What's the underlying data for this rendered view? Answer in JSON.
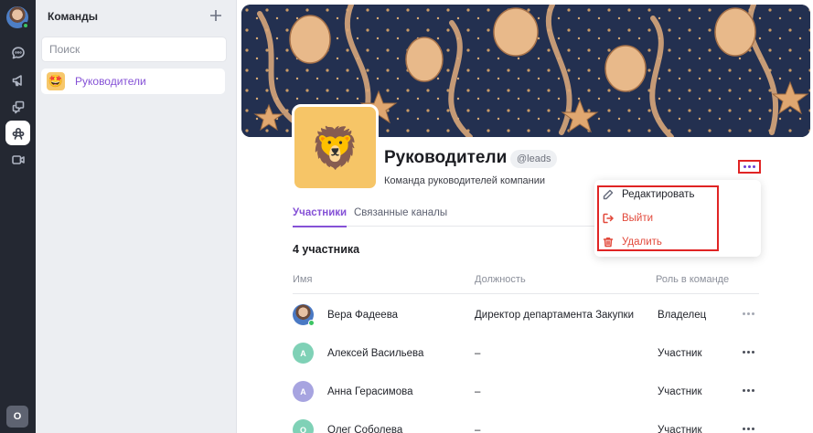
{
  "rail": {
    "items": [
      {
        "icon": "chat-icon"
      },
      {
        "icon": "megaphone-icon"
      },
      {
        "icon": "threads-icon"
      },
      {
        "icon": "teams-icon",
        "active": true
      },
      {
        "icon": "video-icon"
      }
    ],
    "user_initial": "O"
  },
  "sidebar": {
    "title": "Команды",
    "search_placeholder": "Поиск",
    "teams": [
      {
        "label": "Руководители",
        "emoji": "🤩"
      }
    ]
  },
  "team": {
    "name": "Руководители",
    "handle": "@leads",
    "description": "Команда руководителей компании",
    "avatar_emoji": "🦁"
  },
  "tabs": [
    "Участники",
    "Связанные каналы"
  ],
  "members": {
    "count_label": "4 участника",
    "columns": [
      "Имя",
      "Должность",
      "Роль в команде"
    ],
    "rows": [
      {
        "initial": "",
        "avatar_color": "#4a79c4",
        "name": "Вера Фадеева",
        "position": "Директор департамента Закупки",
        "role": "Владелец",
        "online": true
      },
      {
        "initial": "А",
        "avatar_color": "#7fd1b6",
        "name": "Алексей Васильева",
        "position": "–",
        "role": "Участник",
        "online": false
      },
      {
        "initial": "А",
        "avatar_color": "#a7a4e0",
        "name": "Анна Герасимова",
        "position": "–",
        "role": "Участник",
        "online": false
      },
      {
        "initial": "О",
        "avatar_color": "#7fd1b6",
        "name": "Олег Соболева",
        "position": "–",
        "role": "Участник",
        "online": false
      }
    ]
  },
  "menu": {
    "edit": "Редактировать",
    "exit": "Выйти",
    "delete": "Удалить"
  },
  "colors": {
    "accent": "#8551d6",
    "danger": "#e2493b",
    "highlight": "#e02424"
  }
}
